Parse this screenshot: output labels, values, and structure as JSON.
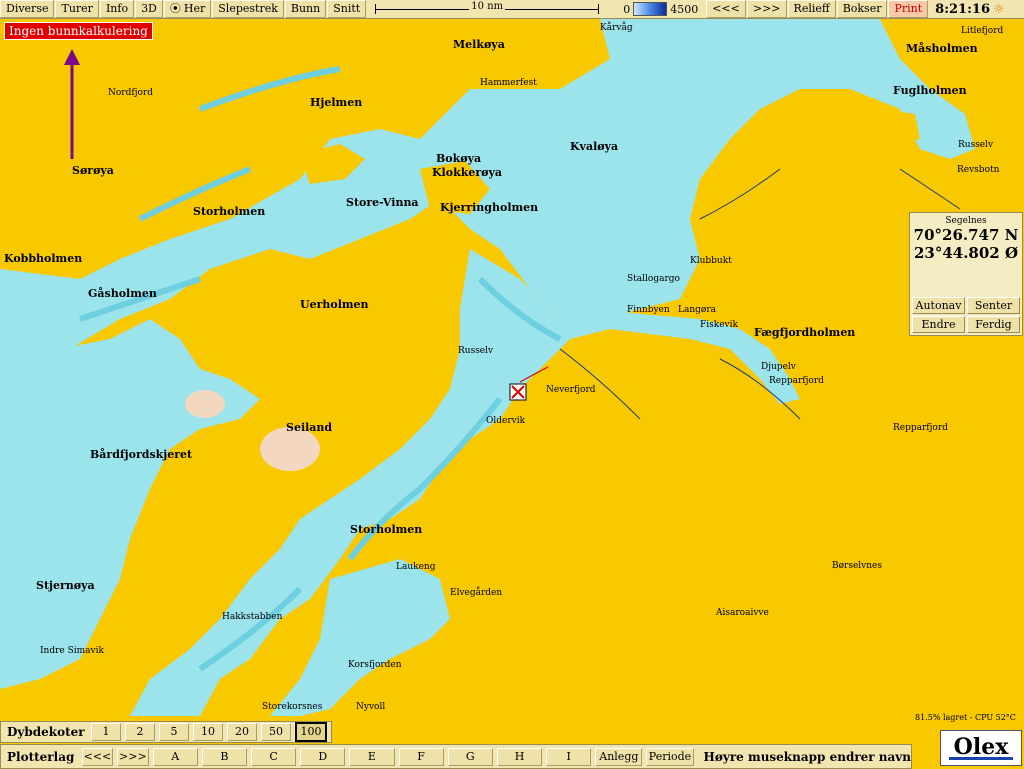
{
  "toolbar": {
    "buttons": [
      "Diverse",
      "Turer",
      "Info",
      "3D",
      "Her",
      "Slepestrek",
      "Bunn",
      "Snitt"
    ],
    "scale_label": "10 nm",
    "depth_min": "0",
    "depth_max": "4500",
    "prev": "<<<",
    "next": ">>>",
    "right_buttons": [
      "Relieff",
      "Bokser",
      "Print"
    ],
    "clock": "8:21:16"
  },
  "warning": "Ingen bunnkalkulering",
  "places": [
    {
      "name": "Melkøya",
      "cls": ""
    },
    {
      "name": "Hammerfest",
      "cls": "reg"
    },
    {
      "name": "Hjelmen",
      "cls": ""
    },
    {
      "name": "Nordfjord",
      "cls": "reg"
    },
    {
      "name": "Sørøya",
      "cls": ""
    },
    {
      "name": "Kvaløya",
      "cls": ""
    },
    {
      "name": "Bokøya",
      "cls": ""
    },
    {
      "name": "Klokkerøya",
      "cls": ""
    },
    {
      "name": "Kjerringholmen",
      "cls": ""
    },
    {
      "name": "Store-Vinna",
      "cls": ""
    },
    {
      "name": "Storholmen",
      "cls": ""
    },
    {
      "name": "Kobbholmen",
      "cls": ""
    },
    {
      "name": "Gåsholmen",
      "cls": ""
    },
    {
      "name": "Uerholmen",
      "cls": ""
    },
    {
      "name": "Seiland",
      "cls": ""
    },
    {
      "name": "Bårdfjordskjeret",
      "cls": ""
    },
    {
      "name": "Storholmen",
      "cls": ""
    },
    {
      "name": "Stjernøya",
      "cls": ""
    },
    {
      "name": "Hakkstabben",
      "cls": "reg"
    },
    {
      "name": "Indre Simavik",
      "cls": "reg"
    },
    {
      "name": "Korsfjorden",
      "cls": "reg"
    },
    {
      "name": "Storekorsnes",
      "cls": "reg"
    },
    {
      "name": "Nyvoll",
      "cls": "reg"
    },
    {
      "name": "Elvegården",
      "cls": "reg"
    },
    {
      "name": "Laukeng",
      "cls": "reg"
    },
    {
      "name": "Oldervik",
      "cls": "reg"
    },
    {
      "name": "Neverfjord",
      "cls": "reg"
    },
    {
      "name": "Russelv",
      "cls": "reg"
    },
    {
      "name": "Finnbyen",
      "cls": "reg"
    },
    {
      "name": "Langøra",
      "cls": "reg"
    },
    {
      "name": "Fiskevik",
      "cls": "reg"
    },
    {
      "name": "Klubbukt",
      "cls": "reg"
    },
    {
      "name": "Stallogargo",
      "cls": "reg"
    },
    {
      "name": "Fægfjordholmen",
      "cls": ""
    },
    {
      "name": "Djupelv",
      "cls": "reg"
    },
    {
      "name": "Repparfjord",
      "cls": "reg"
    },
    {
      "name": "Repparfjord",
      "cls": "reg"
    },
    {
      "name": "Børselvnes",
      "cls": "reg"
    },
    {
      "name": "Aisaroaivve",
      "cls": "reg"
    },
    {
      "name": "Fuglholmen",
      "cls": ""
    },
    {
      "name": "Måsholmen",
      "cls": ""
    },
    {
      "name": "Revsbotn",
      "cls": "reg"
    },
    {
      "name": "Russelv",
      "cls": "reg"
    },
    {
      "name": "Litlefjord",
      "cls": "reg"
    },
    {
      "name": "Kårvåg",
      "cls": "reg"
    }
  ],
  "coords": {
    "title": "Segelnes",
    "lat": "70°26.747 N",
    "lon": "23°44.802 Ø",
    "buttons": [
      "Autonav",
      "Senter",
      "Endre",
      "Ferdig"
    ]
  },
  "status_text": "81.5% lagret - CPU 52°C",
  "depth_contours": {
    "label": "Dybdekoter",
    "values": [
      "1",
      "2",
      "5",
      "10",
      "20",
      "50",
      "100"
    ],
    "selected": "100"
  },
  "plotter": {
    "label": "Plotterlag",
    "prev": "<<<",
    "next": ">>>",
    "layers": [
      "A",
      "B",
      "C",
      "D",
      "E",
      "F",
      "G",
      "H",
      "I"
    ],
    "anlegg": "Anlegg",
    "periode": "Periode",
    "hint": "Høyre museknapp endrer navn"
  },
  "logo": "Olex",
  "colors": {
    "land": "#f8c800",
    "sea": "#9be4ec",
    "deep": "#6dcfe0",
    "ui": "#f2e6b0"
  }
}
